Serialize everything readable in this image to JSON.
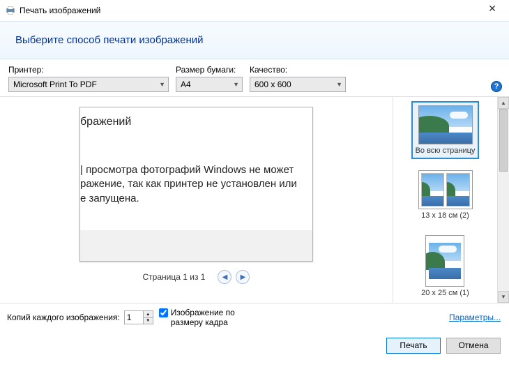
{
  "window": {
    "title": "Печать изображений"
  },
  "heading": "Выберите способ печати изображений",
  "fields": {
    "printer": {
      "label": "Принтер:",
      "value": "Microsoft Print To PDF"
    },
    "paper": {
      "label": "Размер бумаги:",
      "value": "A4"
    },
    "quality": {
      "label": "Качество:",
      "value": "600 x 600"
    }
  },
  "preview": {
    "title_fragment": "бражений",
    "body_line1": "| просмотра фотографий Windows не может",
    "body_line2": "ражение, так как принтер не установлен или",
    "body_line3": "е запущена.",
    "pager": "Страница 1 из 1"
  },
  "layouts": {
    "full": "Во всю страницу",
    "l13x18": "13 x 18 см (2)",
    "l20x25": "20 x 25 см (1)"
  },
  "lower": {
    "copies_label": "Копий каждого изображения:",
    "copies_value": "1",
    "fit_label": "Изображение по размеру кадра",
    "params_link": "Параметры..."
  },
  "buttons": {
    "print": "Печать",
    "cancel": "Отмена"
  }
}
